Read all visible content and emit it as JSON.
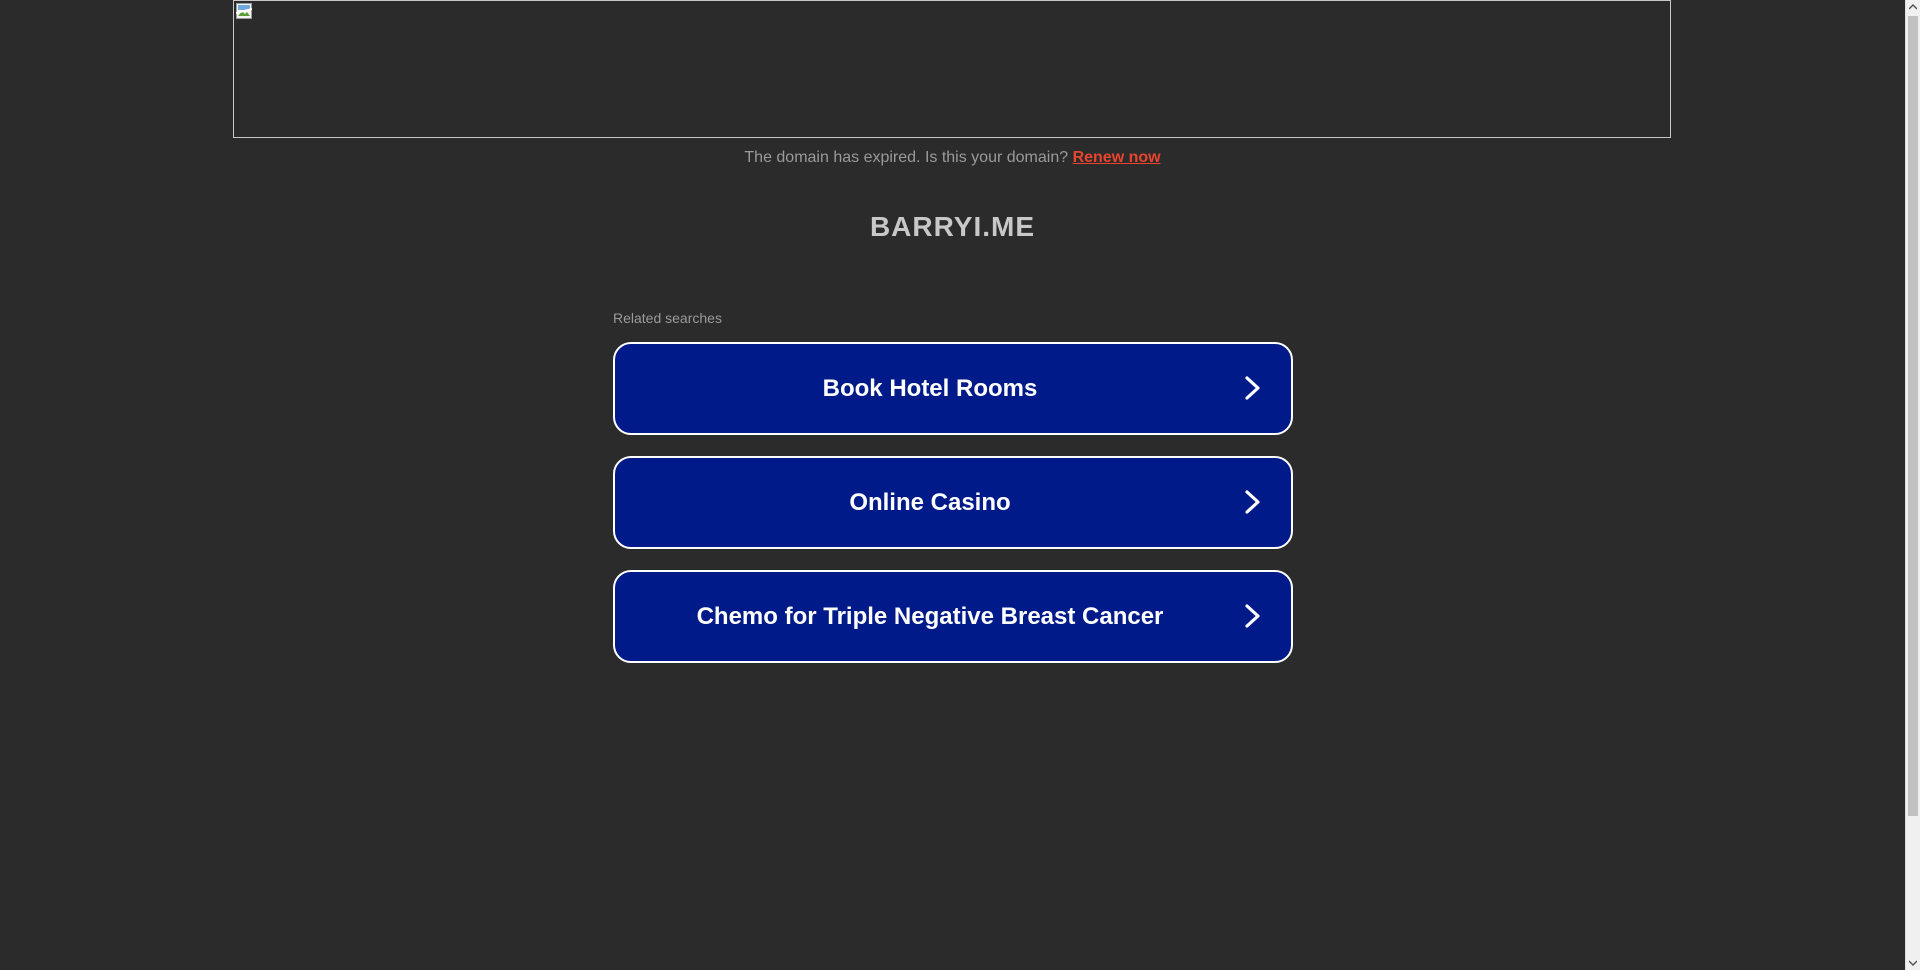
{
  "notice": {
    "text": "The domain has expired. Is this your domain?",
    "link_label": "Renew now"
  },
  "domain": {
    "name": "BARRYI.ME"
  },
  "related": {
    "heading": "Related searches",
    "items": [
      {
        "label": "Book Hotel Rooms"
      },
      {
        "label": "Online Casino"
      },
      {
        "label": "Chemo for Triple Negative Breast Cancer"
      }
    ]
  },
  "colors": {
    "background": "#2b2b2b",
    "button": "#011a8a",
    "link": "#e8442e"
  },
  "icons": {
    "banner": "broken-image-icon",
    "button_arrow": "chevron-right-icon"
  }
}
